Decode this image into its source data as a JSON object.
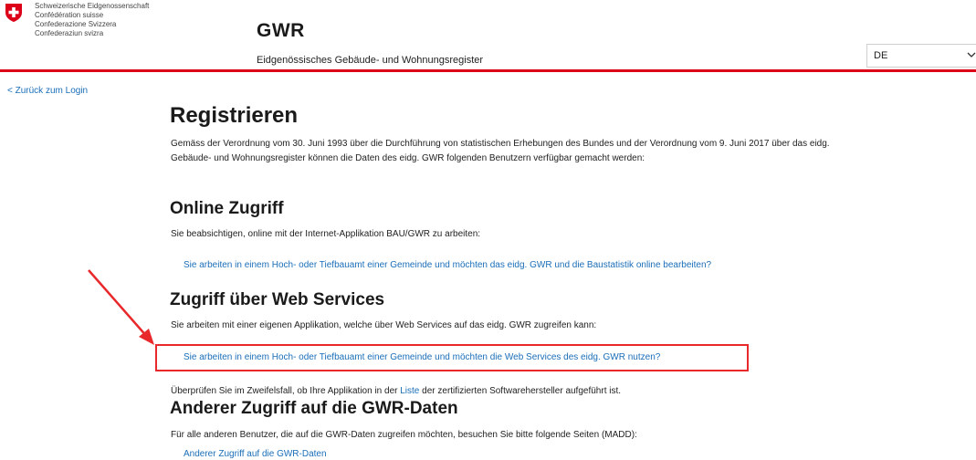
{
  "header": {
    "federation_lines": [
      "Schweizerische Eidgenossenschaft",
      "Confédération suisse",
      "Confederazione Svizzera",
      "Confederaziun svizra"
    ],
    "title": "GWR",
    "subtitle": "Eidgenössisches Gebäude- und Wohnungsregister",
    "language": {
      "selected": "DE",
      "icon": "chevron-down-icon"
    },
    "flag_icon": "swiss-flag-icon"
  },
  "nav": {
    "back_link": "< Zurück zum Login"
  },
  "main": {
    "title": "Registrieren",
    "intro": "Gemäss der Verordnung vom 30. Juni 1993 über die Durchführung von statistischen Erhebungen des Bundes und der Verordnung vom 9. Juni 2017 über das eidg. Gebäude- und Wohnungsregister können die Daten des eidg. GWR folgenden Benutzern verfügbar gemacht werden:",
    "online": {
      "heading": "Online Zugriff",
      "text": "Sie beabsichtigen, online mit der Internet-Applikation BAU/GWR zu arbeiten:",
      "link": "Sie arbeiten in einem Hoch- oder Tiefbauamt einer Gemeinde und möchten das eidg. GWR und die Baustatistik online bearbeiten?"
    },
    "webservices": {
      "heading": "Zugriff über Web Services",
      "text": "Sie arbeiten mit einer eigenen Applikation, welche über Web Services auf das eidg. GWR zugreifen kann:",
      "link": "Sie arbeiten in einem Hoch- oder Tiefbauamt einer Gemeinde und möchten die Web Services des eidg. GWR nutzen?",
      "check_before": "Überprüfen Sie im Zweifelsfall, ob Ihre Applikation in der ",
      "check_link": "Liste",
      "check_after": " der zertifizierten Softwarehersteller aufgeführt ist."
    },
    "other": {
      "heading": "Anderer Zugriff auf die GWR-Daten",
      "text": "Für alle anderen Benutzer, die auf die GWR-Daten zugreifen möchten, besuchen Sie bitte folgende Seiten (MADD):",
      "link": "Anderer Zugriff auf die GWR-Daten"
    }
  },
  "annotation": {
    "color": "#e8282b"
  },
  "colors": {
    "brand_red": "#dc0018",
    "link_blue": "#1a6eb8"
  }
}
